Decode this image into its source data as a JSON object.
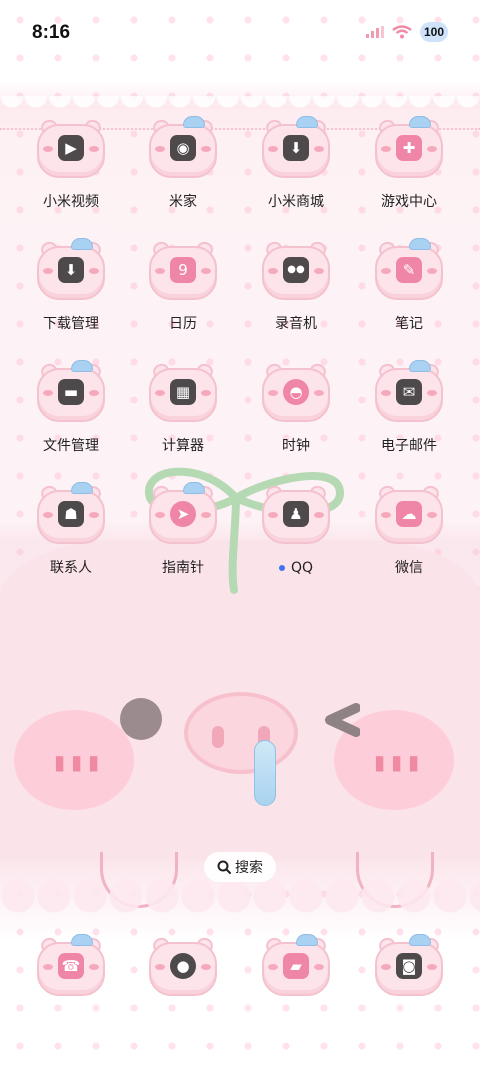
{
  "status": {
    "time": "8:16",
    "battery": "100",
    "signal_icon": "signal-icon",
    "wifi_icon": "wifi-icon"
  },
  "apps": [
    {
      "label": "小米视频",
      "icon": "video-icon",
      "glyph": "▶"
    },
    {
      "label": "米家",
      "icon": "mijia-icon",
      "glyph": "◉"
    },
    {
      "label": "小米商城",
      "icon": "mall-icon",
      "glyph": "⬇"
    },
    {
      "label": "游戏中心",
      "icon": "game-icon",
      "glyph": "✚"
    },
    {
      "label": "下载管理",
      "icon": "download-icon",
      "glyph": "⬇"
    },
    {
      "label": "日历",
      "icon": "calendar-icon",
      "glyph": "9"
    },
    {
      "label": "录音机",
      "icon": "recorder-icon",
      "glyph": "●●"
    },
    {
      "label": "笔记",
      "icon": "notes-icon",
      "glyph": "✎"
    },
    {
      "label": "文件管理",
      "icon": "folder-icon",
      "glyph": "▬"
    },
    {
      "label": "计算器",
      "icon": "calculator-icon",
      "glyph": "▦"
    },
    {
      "label": "时钟",
      "icon": "clock-icon",
      "glyph": "◓"
    },
    {
      "label": "电子邮件",
      "icon": "mail-icon",
      "glyph": "✉"
    },
    {
      "label": "联系人",
      "icon": "contacts-icon",
      "glyph": "☗"
    },
    {
      "label": "指南针",
      "icon": "compass-icon",
      "glyph": "➤"
    },
    {
      "label": "QQ",
      "icon": "qq-icon",
      "glyph": "♟"
    },
    {
      "label": "微信",
      "icon": "wechat-icon",
      "glyph": "☁"
    }
  ],
  "search": {
    "label": "搜索",
    "icon": "search-icon"
  },
  "dock": [
    {
      "icon": "phone-icon",
      "glyph": "☎"
    },
    {
      "icon": "browser-icon",
      "glyph": "●"
    },
    {
      "icon": "messages-icon",
      "glyph": "▰"
    },
    {
      "icon": "camera-icon",
      "glyph": "◙"
    }
  ],
  "colors": {
    "accent": "#ef86a8",
    "wallpaper": "#fbe3ea",
    "glyph": "#4e4a4c",
    "unread_dot": "#3e74f0"
  }
}
